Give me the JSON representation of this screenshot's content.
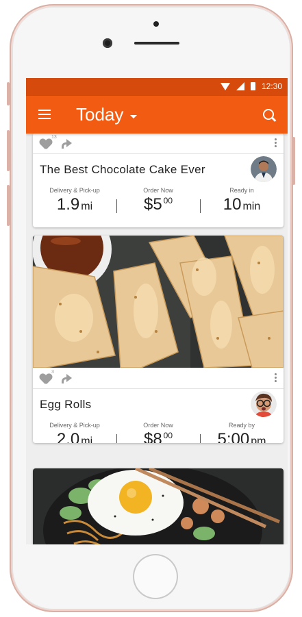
{
  "status": {
    "time": "12:30"
  },
  "appbar": {
    "title": "Today"
  },
  "cards": [
    {
      "likes": "13",
      "title": "The Best Chocolate Cake Ever",
      "stats": [
        {
          "label": "Delivery & Pick-up",
          "value": "1.9",
          "unit": "mi"
        },
        {
          "label": "Order Now",
          "currency": "$",
          "value": "5",
          "cents": "00"
        },
        {
          "label": "Ready in",
          "value": "10",
          "unit": "min"
        }
      ]
    },
    {
      "likes": "3",
      "title": "Egg Rolls",
      "stats": [
        {
          "label": "Delivery & Pick-up",
          "value": "2.0",
          "unit": "mi"
        },
        {
          "label": "Order Now",
          "currency": "$",
          "value": "8",
          "cents": "00"
        },
        {
          "label": "Ready by",
          "value": "5:00",
          "unit": "pm"
        }
      ]
    }
  ],
  "colors": {
    "statusbar": "#d64a0b",
    "appbar": "#f25b12",
    "frame": "#ecd0c9"
  }
}
